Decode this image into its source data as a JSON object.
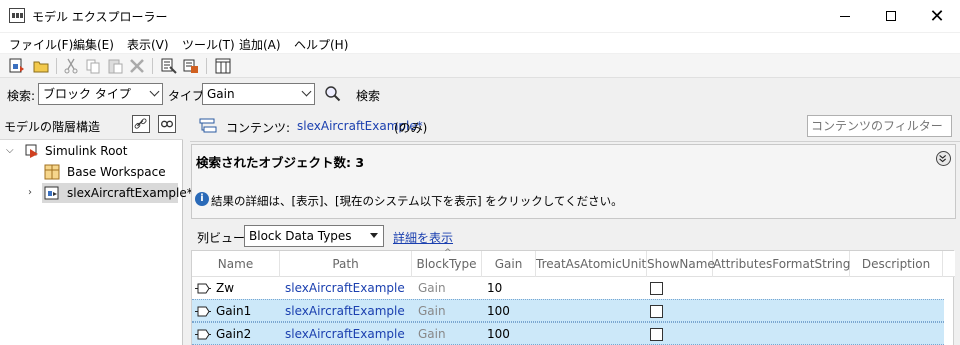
{
  "window": {
    "title": "モデル エクスプローラー",
    "close_glyph": "✕"
  },
  "menu": [
    "ファイル(F)",
    "編集(E)",
    "表示(V)",
    "ツール(T)",
    "追加(A)",
    "ヘルプ(H)"
  ],
  "toolbar_icons": [
    "new-model-icon",
    "open-folder-icon",
    "cut-icon",
    "copy-icon",
    "paste-icon",
    "delete-icon",
    "model-settings-icon",
    "data-dictionary-icon",
    "columns-icon"
  ],
  "search": {
    "label": "検索:",
    "scope_value": "ブロック タイプ",
    "type_label": "タイプ:",
    "type_value": "Gain",
    "button": "検索"
  },
  "left": {
    "heading": "モデルの階層構造",
    "tree": [
      {
        "label": "Simulink Root",
        "expanded": true
      },
      {
        "label": "Base Workspace"
      },
      {
        "label": "slexAircraftExample*",
        "selected": true
      }
    ]
  },
  "contents": {
    "label": "コンテンツ:",
    "model": "slexAircraftExample*",
    "scope": "(のみ)",
    "filter_placeholder": "コンテンツのフィルター"
  },
  "results": {
    "count_text": "検索されたオブジェクト数: 3",
    "info": "結果の詳細は、[表示]、[現在のシステム以下を表示] をクリックしてください。"
  },
  "column_view": {
    "label": "列ビュー:",
    "value": "Block Data Types",
    "details_link": "詳細を表示"
  },
  "table": {
    "columns": [
      "Name",
      "Path",
      "BlockType",
      "Gain",
      "TreatAsAtomicUnit",
      "ShowName",
      "AttributesFormatString",
      "Description"
    ],
    "rows": [
      {
        "name": "Zw",
        "path": "slexAircraftExample",
        "blocktype": "Gain",
        "gain": "10",
        "showname": false,
        "selected": false
      },
      {
        "name": "Gain1",
        "path": "slexAircraftExample",
        "blocktype": "Gain",
        "gain": "100",
        "showname": false,
        "selected": true
      },
      {
        "name": "Gain2",
        "path": "slexAircraftExample",
        "blocktype": "Gain",
        "gain": "100",
        "showname": false,
        "selected": true
      }
    ]
  },
  "colors": {
    "link": "#1a3faf",
    "selection": "#cce8f9",
    "muted": "#888888"
  }
}
